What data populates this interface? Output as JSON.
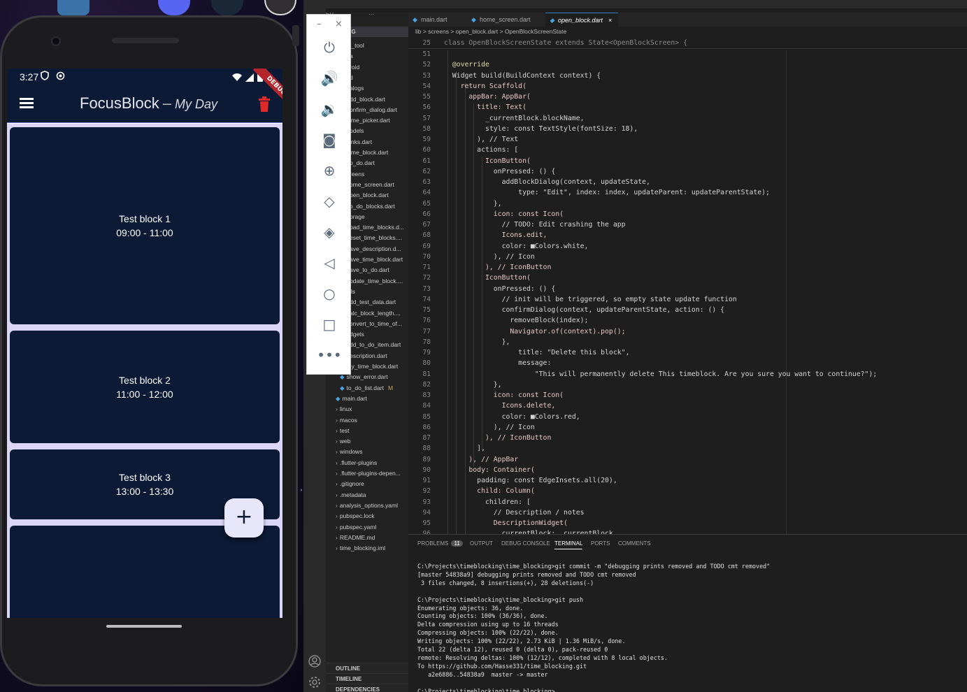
{
  "phone": {
    "status_time": "3:27",
    "debug_banner": "DEBUG",
    "app_title": "FocusBlock",
    "app_title_separator": "–",
    "app_subtitle": "My Day",
    "blocks": [
      {
        "name": "Test block 1",
        "time": "09:00 - 11:00"
      },
      {
        "name": "Test block 2",
        "time": "11:00 - 12:00"
      },
      {
        "name": "Test block 3",
        "time": "13:00 - 13:30"
      },
      {
        "name": "",
        "time": ""
      }
    ],
    "fab_label": "+",
    "colors": {
      "app_bar": "#0c1a35",
      "background": "#dcd6f6",
      "trash": "#e02a2a"
    }
  },
  "emulator_toolbar": {
    "minimize": "–",
    "close": "×",
    "buttons": [
      "power-icon",
      "volume-up-icon",
      "volume-down-icon",
      "camera-icon",
      "zoom-icon",
      "rotate-left-icon",
      "rotate-right-icon",
      "back-icon",
      "home-icon",
      "overview-icon",
      "more-icon"
    ]
  },
  "vscode": {
    "tabs": [
      "main.dart",
      "home_screen.dart",
      "open_block.dart"
    ],
    "breadcrumb": "lib > screens > open_block.dart > OpenBlockScreenState",
    "explorer_header": "BLOCKING",
    "explorer_items": [
      {
        "label": "t_tool",
        "indent": 0
      },
      {
        "label": "a",
        "indent": 0
      },
      {
        "label": "roid",
        "indent": 0
      },
      {
        "label": "d",
        "indent": 0
      },
      {
        "label": "alogs",
        "indent": 0
      },
      {
        "label": "dd_block.dart",
        "indent": 0
      },
      {
        "label": "onfirm_dialog.dart",
        "indent": 0
      },
      {
        "label": "ime_picker.dart",
        "indent": 0
      },
      {
        "label": "odels",
        "indent": 0
      },
      {
        "label": "inks.dart",
        "indent": 0
      },
      {
        "label": "ime_block.dart",
        "indent": 0
      },
      {
        "label": "o_do.dart",
        "indent": 0
      },
      {
        "label": "reens",
        "indent": 0
      },
      {
        "label": "ome_screen.dart",
        "indent": 0
      },
      {
        "label": "pen_block.dart",
        "indent": 0
      },
      {
        "label": "o_do_blocks.dart",
        "indent": 0
      },
      {
        "label": "orage",
        "indent": 0
      },
      {
        "label": "oad_time_blocks.d...",
        "indent": 0
      },
      {
        "label": "eset_time_blocks....",
        "indent": 0
      },
      {
        "label": "ave_description.d...",
        "indent": 0
      },
      {
        "label": "ave_time_block.dart",
        "indent": 0
      },
      {
        "label": "ave_to_do.dart",
        "indent": 0
      },
      {
        "label": "pdate_time_block....",
        "indent": 0
      },
      {
        "label": "ils",
        "indent": 0
      },
      {
        "label": "dd_test_data.dart",
        "indent": 0
      },
      {
        "label": "alc_block_length....",
        "indent": 0
      },
      {
        "label": "onvert_to_time_of...",
        "indent": 0
      },
      {
        "label": "dgets",
        "indent": 0
      },
      {
        "label": "dd_to_do_item.dart",
        "indent": 0
      },
      {
        "label": "description.dart",
        "indent": 1
      },
      {
        "label": "my_time_block.dart",
        "indent": 1
      },
      {
        "label": "show_error.dart",
        "indent": 1
      },
      {
        "label": "to_do_list.dart",
        "indent": 1,
        "status": "M"
      },
      {
        "label": "main.dart",
        "indent": 2
      },
      {
        "label": "linux",
        "indent": 3
      },
      {
        "label": "macos",
        "indent": 3
      },
      {
        "label": "test",
        "indent": 3
      },
      {
        "label": "web",
        "indent": 3
      },
      {
        "label": "windows",
        "indent": 3
      },
      {
        "label": ".flutter-plugins",
        "indent": 3
      },
      {
        "label": ".flutter-plugins-depen...",
        "indent": 3
      },
      {
        "label": ".gitignore",
        "indent": 3
      },
      {
        "label": ".metadata",
        "indent": 3
      },
      {
        "label": "analysis_options.yaml",
        "indent": 3
      },
      {
        "label": "pubspec.lock",
        "indent": 3
      },
      {
        "label": "pubspec.yaml",
        "indent": 3
      },
      {
        "label": "README.md",
        "indent": 3
      },
      {
        "label": "time_blocking.iml",
        "indent": 3
      }
    ],
    "sidebar_sections": [
      "OUTLINE",
      "TIMELINE",
      "DEPENDENCIES"
    ],
    "sticky_line": {
      "num": "25",
      "text": "class OpenBlockScreenState extends State<OpenBlockScreen> {"
    },
    "code_lines": [
      {
        "num": "51",
        "text": ""
      },
      {
        "num": "52",
        "text": "  @override"
      },
      {
        "num": "53",
        "text": "  Widget build(BuildContext context) {"
      },
      {
        "num": "54",
        "text": "    return Scaffold("
      },
      {
        "num": "55",
        "text": "      appBar: AppBar("
      },
      {
        "num": "56",
        "text": "        title: Text("
      },
      {
        "num": "57",
        "text": "          _currentBlock.blockName,"
      },
      {
        "num": "58",
        "text": "          style: const TextStyle(fontSize: 18),"
      },
      {
        "num": "59",
        "text": "        ), // Text"
      },
      {
        "num": "60",
        "text": "        actions: ["
      },
      {
        "num": "61",
        "text": "          IconButton("
      },
      {
        "num": "62",
        "text": "            onPressed: () {"
      },
      {
        "num": "63",
        "text": "              addBlockDialog(context, updateState,"
      },
      {
        "num": "64",
        "text": "                  type: \"Edit\", index: index, updateParent: updateParentState);"
      },
      {
        "num": "65",
        "text": "            },"
      },
      {
        "num": "66",
        "text": "            icon: const Icon("
      },
      {
        "num": "67",
        "text": "              // TODO: Edit crashing the app"
      },
      {
        "num": "68",
        "text": "              Icons.edit,"
      },
      {
        "num": "69",
        "text": "              color: ■Colors.white,"
      },
      {
        "num": "70",
        "text": "            ), // Icon"
      },
      {
        "num": "71",
        "text": "          ), // IconButton"
      },
      {
        "num": "72",
        "text": "          IconButton("
      },
      {
        "num": "73",
        "text": "            onPressed: () {"
      },
      {
        "num": "74",
        "text": "              // init will be triggered, so empty state update function"
      },
      {
        "num": "75",
        "text": "              confirmDialog(context, updateParentState, action: () {"
      },
      {
        "num": "76",
        "text": "                removeBlock(index);"
      },
      {
        "num": "77",
        "text": "                Navigator.of(context).pop();"
      },
      {
        "num": "78",
        "text": "              },"
      },
      {
        "num": "79",
        "text": "                  title: \"Delete this block\","
      },
      {
        "num": "80",
        "text": "                  message:"
      },
      {
        "num": "81",
        "text": "                      \"This will permanently delete This timeblock. Are you sure you want to continue?\");"
      },
      {
        "num": "82",
        "text": "            },"
      },
      {
        "num": "83",
        "text": "            icon: const Icon("
      },
      {
        "num": "84",
        "text": "              Icons.delete,"
      },
      {
        "num": "85",
        "text": "              color: ■Colors.red,"
      },
      {
        "num": "86",
        "text": "            ), // Icon"
      },
      {
        "num": "87",
        "text": "          ), // IconButton"
      },
      {
        "num": "88",
        "text": "        ],"
      },
      {
        "num": "89",
        "text": "      ), // AppBar"
      },
      {
        "num": "90",
        "text": "      body: Container("
      },
      {
        "num": "91",
        "text": "        padding: const EdgeInsets.all(20),"
      },
      {
        "num": "92",
        "text": "        child: Column("
      },
      {
        "num": "93",
        "text": "          children: ["
      },
      {
        "num": "94",
        "text": "            // Description / notes"
      },
      {
        "num": "95",
        "text": "            DescriptionWidget("
      },
      {
        "num": "96",
        "text": "              currentBlock: _currentBlock,"
      }
    ],
    "panel_tabs": [
      "PROBLEMS",
      "OUTPUT",
      "DEBUG CONSOLE",
      "TERMINAL",
      "PORTS",
      "COMMENTS"
    ],
    "problems_count": "11",
    "terminal_lines": [
      "C:\\Projects\\timeblocking\\time_blocking>git commit -m \"debugging prints removed and TODO cmt removed\"",
      "[master 54838a9] debugging prints removed and TODO cmt removed",
      " 3 files changed, 8 insertions(+), 28 deletions(-)",
      "",
      "C:\\Projects\\timeblocking\\time_blocking>git push",
      "Enumerating objects: 36, done.",
      "Counting objects: 100% (36/36), done.",
      "Delta compression using up to 16 threads",
      "Compressing objects: 100% (22/22), done.",
      "Writing objects: 100% (22/22), 2.73 KiB | 1.36 MiB/s, done.",
      "Total 22 (delta 12), reused 0 (delta 0), pack-reused 0",
      "remote: Resolving deltas: 100% (12/12), completed with 8 local objects.",
      "To https://github.com/Hasse331/time_blocking.git",
      "   a2e6886..54838a9  master -> master",
      "",
      "C:\\Projects\\timeblocking\\time_blocking>"
    ]
  }
}
